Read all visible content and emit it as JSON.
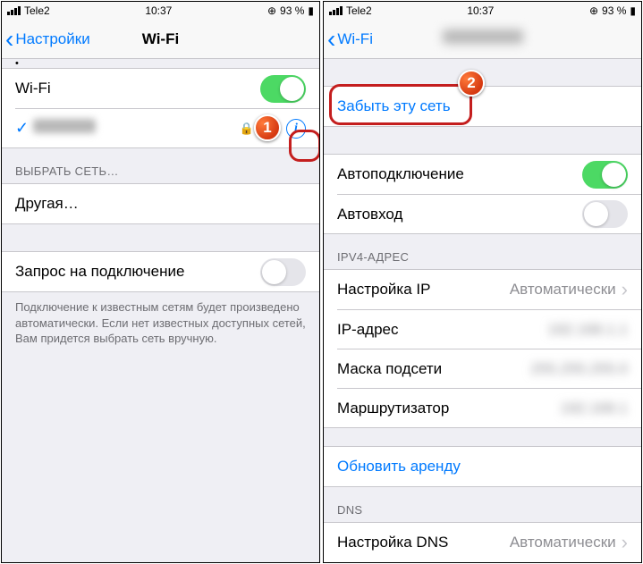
{
  "status": {
    "carrier": "Tele2",
    "time": "10:37",
    "battery": "93 %"
  },
  "left": {
    "back": "Настройки",
    "title": "Wi-Fi",
    "wifiRow": "Wi-Fi",
    "chooseHdr": "ВЫБРАТЬ СЕТЬ…",
    "other": "Другая…",
    "ask": "Запрос на подключение",
    "footer": "Подключение к известным сетям будет произведено автоматически. Если нет известных доступных сетей, Вам придется выбрать сеть вручную."
  },
  "right": {
    "back": "Wi-Fi",
    "forget": "Забыть эту сеть",
    "auto": "Автоподключение",
    "autoLogin": "Автовход",
    "ipv4Hdr": "IPV4-АДРЕС",
    "ipCfg": "Настройка IP",
    "ipCfgVal": "Автоматически",
    "ipAddr": "IP-адрес",
    "mask": "Маска подсети",
    "router": "Маршрутизатор",
    "renew": "Обновить аренду",
    "dnsHdr": "DNS",
    "dnsCfg": "Настройка DNS",
    "dnsCfgVal": "Автоматически"
  },
  "badges": {
    "one": "1",
    "two": "2"
  }
}
